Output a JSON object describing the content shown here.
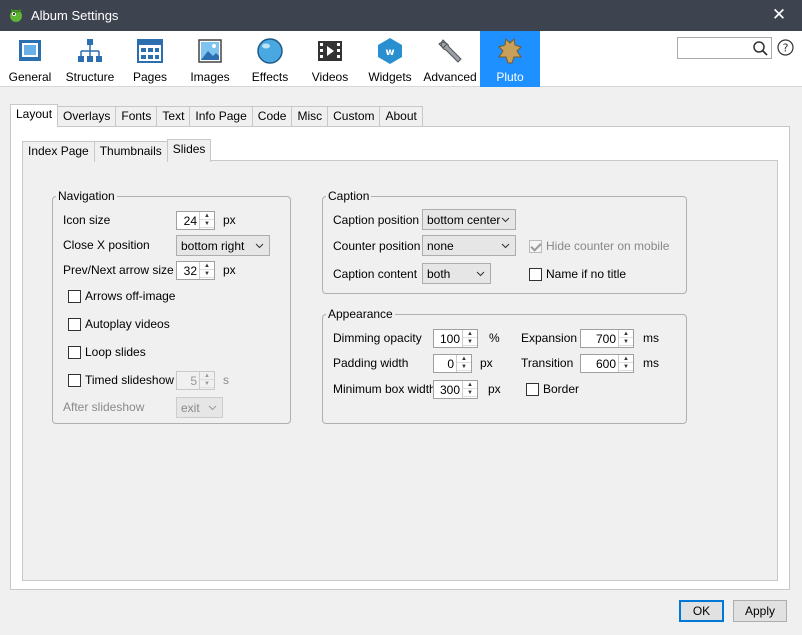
{
  "window": {
    "title": "Album Settings",
    "close_glyph": "✕"
  },
  "toolbar": {
    "items": [
      {
        "label": "General",
        "icon": "general-icon"
      },
      {
        "label": "Structure",
        "icon": "structure-icon"
      },
      {
        "label": "Pages",
        "icon": "pages-icon"
      },
      {
        "label": "Images",
        "icon": "images-icon"
      },
      {
        "label": "Effects",
        "icon": "effects-icon"
      },
      {
        "label": "Videos",
        "icon": "videos-icon"
      },
      {
        "label": "Widgets",
        "icon": "widgets-icon"
      },
      {
        "label": "Advanced",
        "icon": "advanced-icon"
      },
      {
        "label": "Pluto",
        "icon": "pluto-icon",
        "active": true
      }
    ],
    "search_value": "",
    "active_color": "#1e90ff"
  },
  "tabs": [
    "Layout",
    "Overlays",
    "Fonts",
    "Text",
    "Info Page",
    "Code",
    "Misc",
    "Custom",
    "About"
  ],
  "subtabs": [
    "Index Page",
    "Thumbnails",
    "Slides"
  ],
  "navigation": {
    "legend": "Navigation",
    "icon_size_label": "Icon size",
    "icon_size": "24",
    "icon_size_unit": "px",
    "closex_label": "Close X position",
    "closex_value": "bottom right",
    "arrow_size_label": "Prev/Next arrow size",
    "arrow_size": "32",
    "arrow_size_unit": "px",
    "arrows_offimage": "Arrows off-image",
    "autoplay_videos": "Autoplay videos",
    "loop_slides": "Loop slides",
    "timed_slideshow": "Timed slideshow",
    "timed_value": "5",
    "timed_unit": "s",
    "after_label": "After slideshow",
    "after_value": "exit"
  },
  "caption": {
    "legend": "Caption",
    "position_label": "Caption position",
    "position_value": "bottom center",
    "counter_label": "Counter position",
    "counter_value": "none",
    "hide_counter": "Hide counter on mobile",
    "content_label": "Caption content",
    "content_value": "both",
    "name_if_no_title": "Name if no title"
  },
  "appearance": {
    "legend": "Appearance",
    "dimming_label": "Dimming opacity",
    "dimming_value": "100",
    "dimming_unit": "%",
    "padding_label": "Padding width",
    "padding_value": "0",
    "padding_unit": "px",
    "minbox_label": "Minimum box width",
    "minbox_value": "300",
    "minbox_unit": "px",
    "expansion_label": "Expansion",
    "expansion_value": "700",
    "expansion_unit": "ms",
    "transition_label": "Transition",
    "transition_value": "600",
    "transition_unit": "ms",
    "border_label": "Border"
  },
  "buttons": {
    "ok": "OK",
    "apply": "Apply"
  }
}
